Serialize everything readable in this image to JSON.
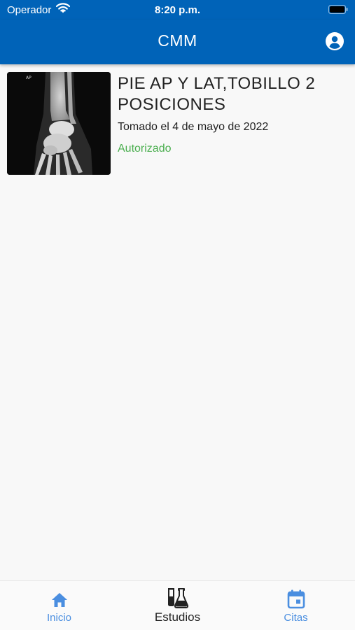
{
  "status_bar": {
    "carrier": "Operador",
    "time": "8:20 p.m."
  },
  "app_bar": {
    "title": "CMM",
    "profile_icon": "account-circle-icon"
  },
  "studies": [
    {
      "thumbnail_label": "AP",
      "title": "PIE  AP Y LAT,TOBILLO 2 POSICIONES",
      "date": "Tomado el 4 de mayo de 2022",
      "status": "Autorizado",
      "status_color": "#4caf50"
    }
  ],
  "tabs": [
    {
      "label": "Inicio",
      "icon": "home-icon",
      "color": "#4a8ee0"
    },
    {
      "label": "Estudios",
      "icon": "lab-flasks-icon",
      "color": "#222222",
      "active": true
    },
    {
      "label": "Citas",
      "icon": "calendar-icon",
      "color": "#4a8ee0"
    }
  ],
  "colors": {
    "app_bar": "#0063b8",
    "background": "#f8f8f8"
  }
}
